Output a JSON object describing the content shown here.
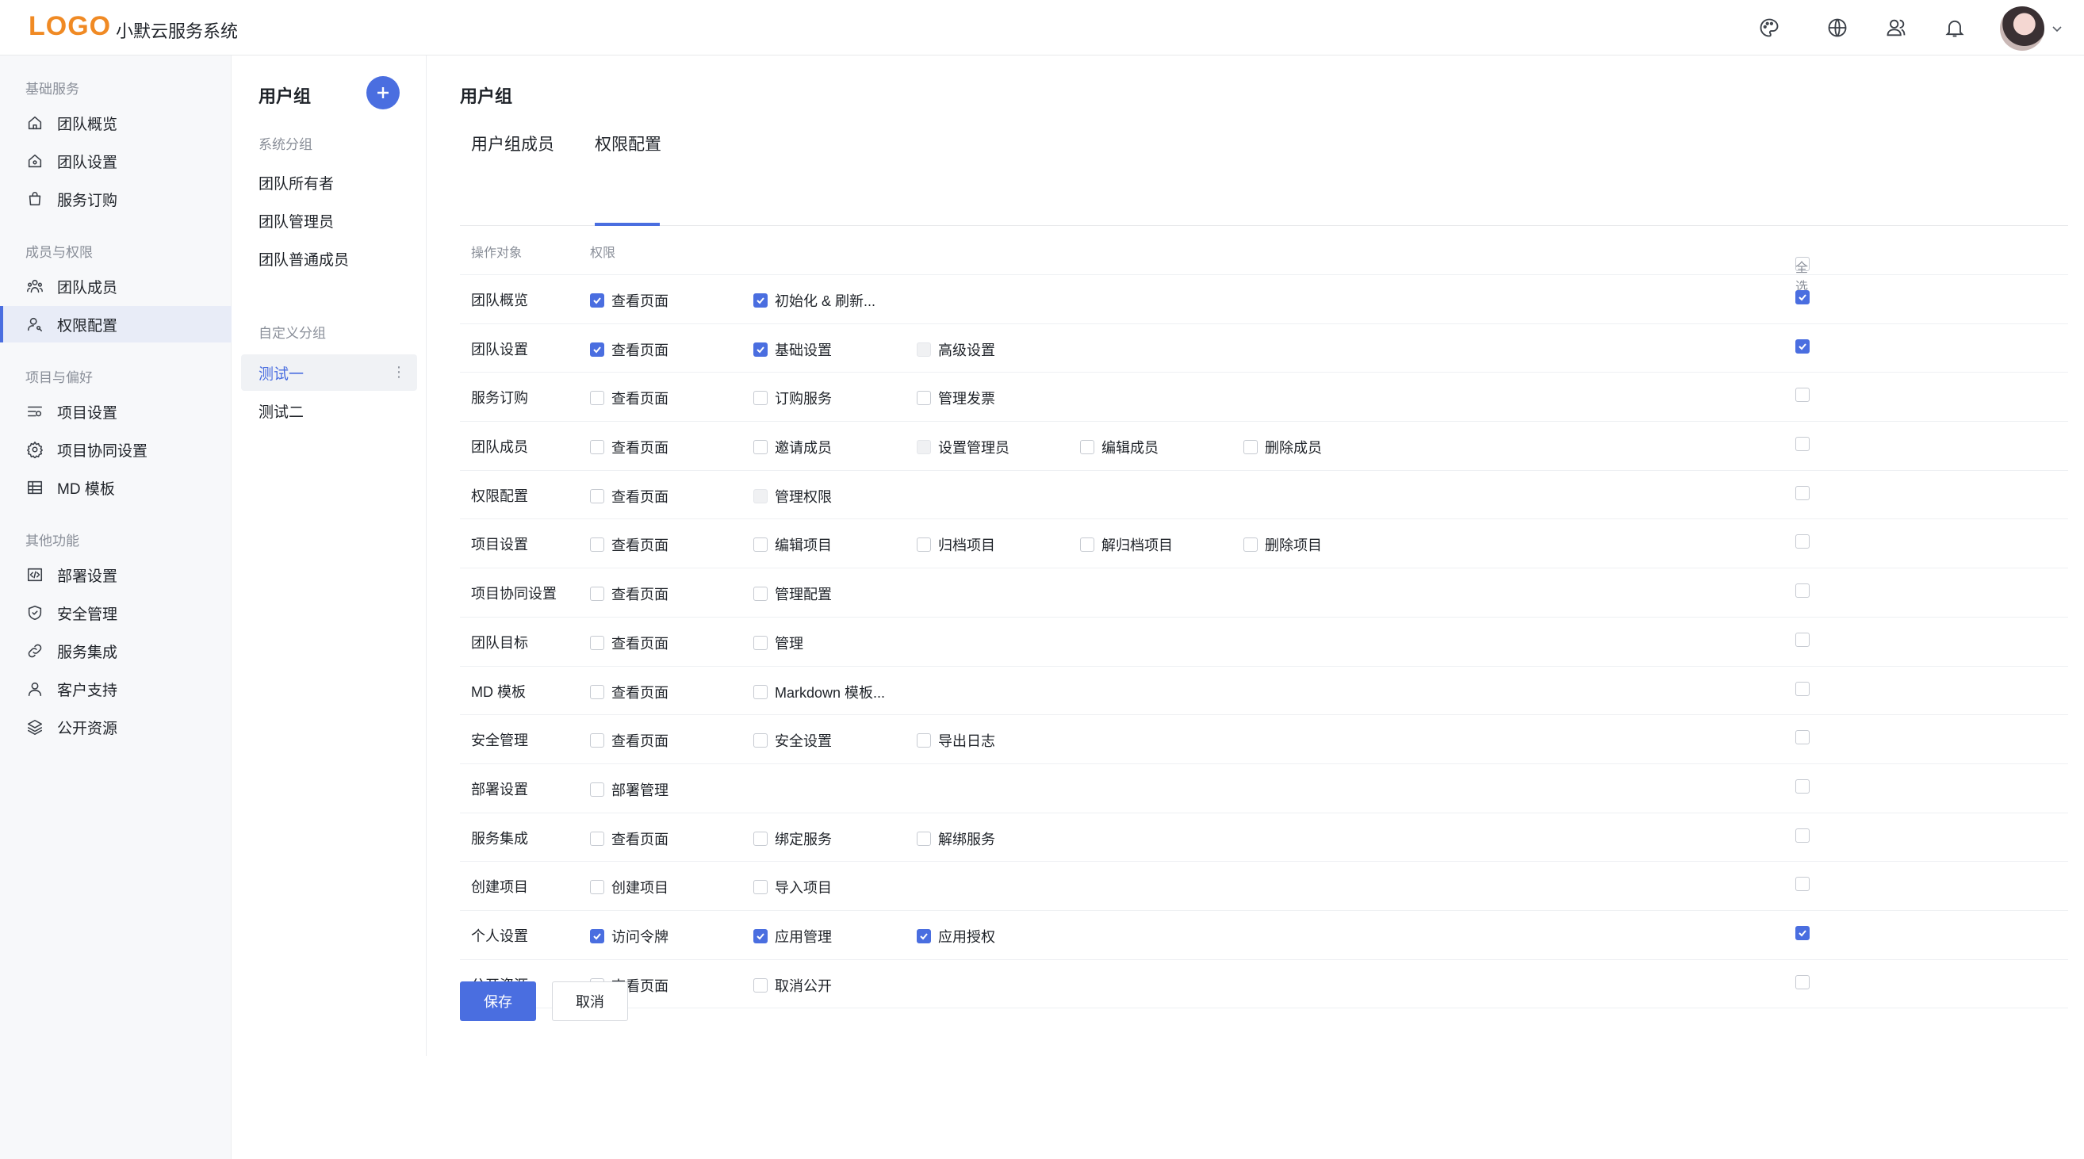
{
  "header": {
    "logo": "LOGO",
    "app_title": "小默云服务系统",
    "icons": [
      "palette-icon",
      "globe-icon",
      "users-icon",
      "bell-icon"
    ]
  },
  "sidebar": {
    "sections": [
      {
        "title": "基础服务",
        "items": [
          {
            "label": "团队概览",
            "icon": "home-icon"
          },
          {
            "label": "团队设置",
            "icon": "home-gear-icon"
          },
          {
            "label": "服务订购",
            "icon": "bag-icon"
          }
        ]
      },
      {
        "title": "成员与权限",
        "items": [
          {
            "label": "团队成员",
            "icon": "team-icon"
          },
          {
            "label": "权限配置",
            "icon": "user-key-icon",
            "active": true
          }
        ]
      },
      {
        "title": "项目与偏好",
        "items": [
          {
            "label": "项目设置",
            "icon": "sliders-icon"
          },
          {
            "label": "项目协同设置",
            "icon": "cog-icon"
          },
          {
            "label": "MD 模板",
            "icon": "table-icon"
          }
        ]
      },
      {
        "title": "其他功能",
        "items": [
          {
            "label": "部署设置",
            "icon": "code-icon"
          },
          {
            "label": "安全管理",
            "icon": "shield-icon"
          },
          {
            "label": "服务集成",
            "icon": "link-icon"
          },
          {
            "label": "客户支持",
            "icon": "user-icon"
          },
          {
            "label": "公开资源",
            "icon": "layers-icon"
          }
        ]
      }
    ]
  },
  "groups": {
    "title": "用户组",
    "system_section": "系统分组",
    "system_items": [
      "团队所有者",
      "团队管理员",
      "团队普通成员"
    ],
    "custom_section": "自定义分组",
    "custom_items": [
      "测试一",
      "测试二"
    ],
    "more": "⋮"
  },
  "main": {
    "title": "用户组",
    "tabs": [
      "用户组成员",
      "权限配置"
    ],
    "active_tab": 1,
    "headers": {
      "object": "操作对象",
      "perm": "权限",
      "select_all": "全选"
    },
    "rows": [
      {
        "object": "团队概览",
        "perms": [
          {
            "label": "查看页面",
            "state": "on"
          },
          {
            "label": "初始化 & 刷新...",
            "state": "on"
          }
        ],
        "all": "on"
      },
      {
        "object": "团队设置",
        "perms": [
          {
            "label": "查看页面",
            "state": "on"
          },
          {
            "label": "基础设置",
            "state": "on"
          },
          {
            "label": "高级设置",
            "state": "dis"
          }
        ],
        "all": "on"
      },
      {
        "object": "服务订购",
        "perms": [
          {
            "label": "查看页面",
            "state": "off"
          },
          {
            "label": "订购服务",
            "state": "off"
          },
          {
            "label": "管理发票",
            "state": "off"
          }
        ],
        "all": "off"
      },
      {
        "object": "团队成员",
        "perms": [
          {
            "label": "查看页面",
            "state": "off"
          },
          {
            "label": "邀请成员",
            "state": "off"
          },
          {
            "label": "设置管理员",
            "state": "dis"
          },
          {
            "label": "编辑成员",
            "state": "off"
          },
          {
            "label": "删除成员",
            "state": "off"
          }
        ],
        "all": "off"
      },
      {
        "object": "权限配置",
        "perms": [
          {
            "label": "查看页面",
            "state": "off"
          },
          {
            "label": "管理权限",
            "state": "dis"
          }
        ],
        "all": "off"
      },
      {
        "object": "项目设置",
        "perms": [
          {
            "label": "查看页面",
            "state": "off"
          },
          {
            "label": "编辑项目",
            "state": "off"
          },
          {
            "label": "归档项目",
            "state": "off"
          },
          {
            "label": "解归档项目",
            "state": "off"
          },
          {
            "label": "删除项目",
            "state": "off"
          }
        ],
        "all": "off"
      },
      {
        "object": "项目协同设置",
        "perms": [
          {
            "label": "查看页面",
            "state": "off"
          },
          {
            "label": "管理配置",
            "state": "off"
          }
        ],
        "all": "off"
      },
      {
        "object": "团队目标",
        "perms": [
          {
            "label": "查看页面",
            "state": "off"
          },
          {
            "label": "管理",
            "state": "off"
          }
        ],
        "all": "off"
      },
      {
        "object": "MD 模板",
        "perms": [
          {
            "label": "查看页面",
            "state": "off"
          },
          {
            "label": "Markdown 模板...",
            "state": "off"
          }
        ],
        "all": "off"
      },
      {
        "object": "安全管理",
        "perms": [
          {
            "label": "查看页面",
            "state": "off"
          },
          {
            "label": "安全设置",
            "state": "off"
          },
          {
            "label": "导出日志",
            "state": "off"
          }
        ],
        "all": "off"
      },
      {
        "object": "部署设置",
        "perms": [
          {
            "label": "部署管理",
            "state": "off"
          }
        ],
        "all": "off"
      },
      {
        "object": "服务集成",
        "perms": [
          {
            "label": "查看页面",
            "state": "off"
          },
          {
            "label": "绑定服务",
            "state": "off"
          },
          {
            "label": "解绑服务",
            "state": "off"
          }
        ],
        "all": "off"
      },
      {
        "object": "创建项目",
        "perms": [
          {
            "label": "创建项目",
            "state": "off"
          },
          {
            "label": "导入项目",
            "state": "off"
          }
        ],
        "all": "off"
      },
      {
        "object": "个人设置",
        "perms": [
          {
            "label": "访问令牌",
            "state": "on"
          },
          {
            "label": "应用管理",
            "state": "on"
          },
          {
            "label": "应用授权",
            "state": "on"
          }
        ],
        "all": "on"
      },
      {
        "object": "公开资源",
        "perms": [
          {
            "label": "查看页面",
            "state": "off"
          },
          {
            "label": "取消公开",
            "state": "off"
          }
        ],
        "all": "off"
      }
    ],
    "save_label": "保存",
    "cancel_label": "取消"
  },
  "colors": {
    "accent": "#4a6ee0",
    "logo": "#f08a24"
  }
}
